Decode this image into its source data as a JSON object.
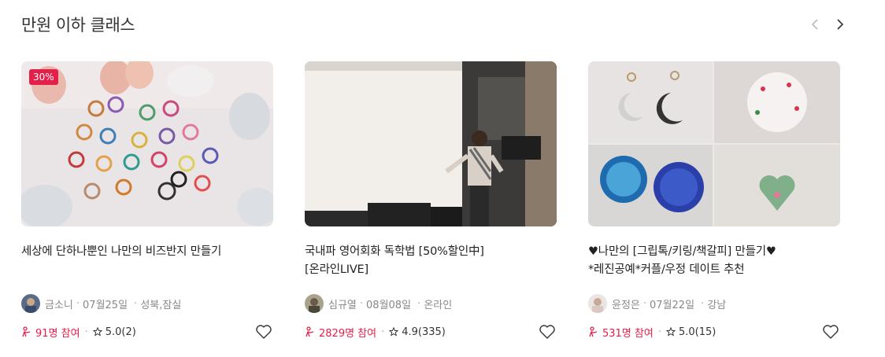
{
  "section": {
    "title": "만원 이하 클래스"
  },
  "nav": {
    "prev": "‹",
    "next": "›"
  },
  "cards": [
    {
      "badge": "30%",
      "title_line1": "세상에 단하나뿐인 나만의 비즈반지 만들기",
      "title_line2": "",
      "creator": "금소니",
      "date": "07월25일",
      "location": "성북,잠실",
      "participants": "91명 참여",
      "rating": "5.0(2)"
    },
    {
      "badge": "",
      "title_line1": "국내파 영어회화 독학법 [50%할인中]",
      "title_line2": "[온라인LIVE]",
      "creator": "심규열",
      "date": "08월08일",
      "location": "온라인",
      "participants": "2829명 참여",
      "rating": "4.9(335)"
    },
    {
      "badge": "",
      "title_line1": "♥나만의 [그립톡/키링/책갈피] 만들기♥",
      "title_line2": "*레진공예*커플/우정 데이트 추천",
      "creator": "윤정은",
      "date": "07월22일",
      "location": "강남",
      "participants": "531명 참여",
      "rating": "5.0(15)"
    }
  ],
  "colors": {
    "accent": "#e3204a",
    "muted": "#888888"
  }
}
